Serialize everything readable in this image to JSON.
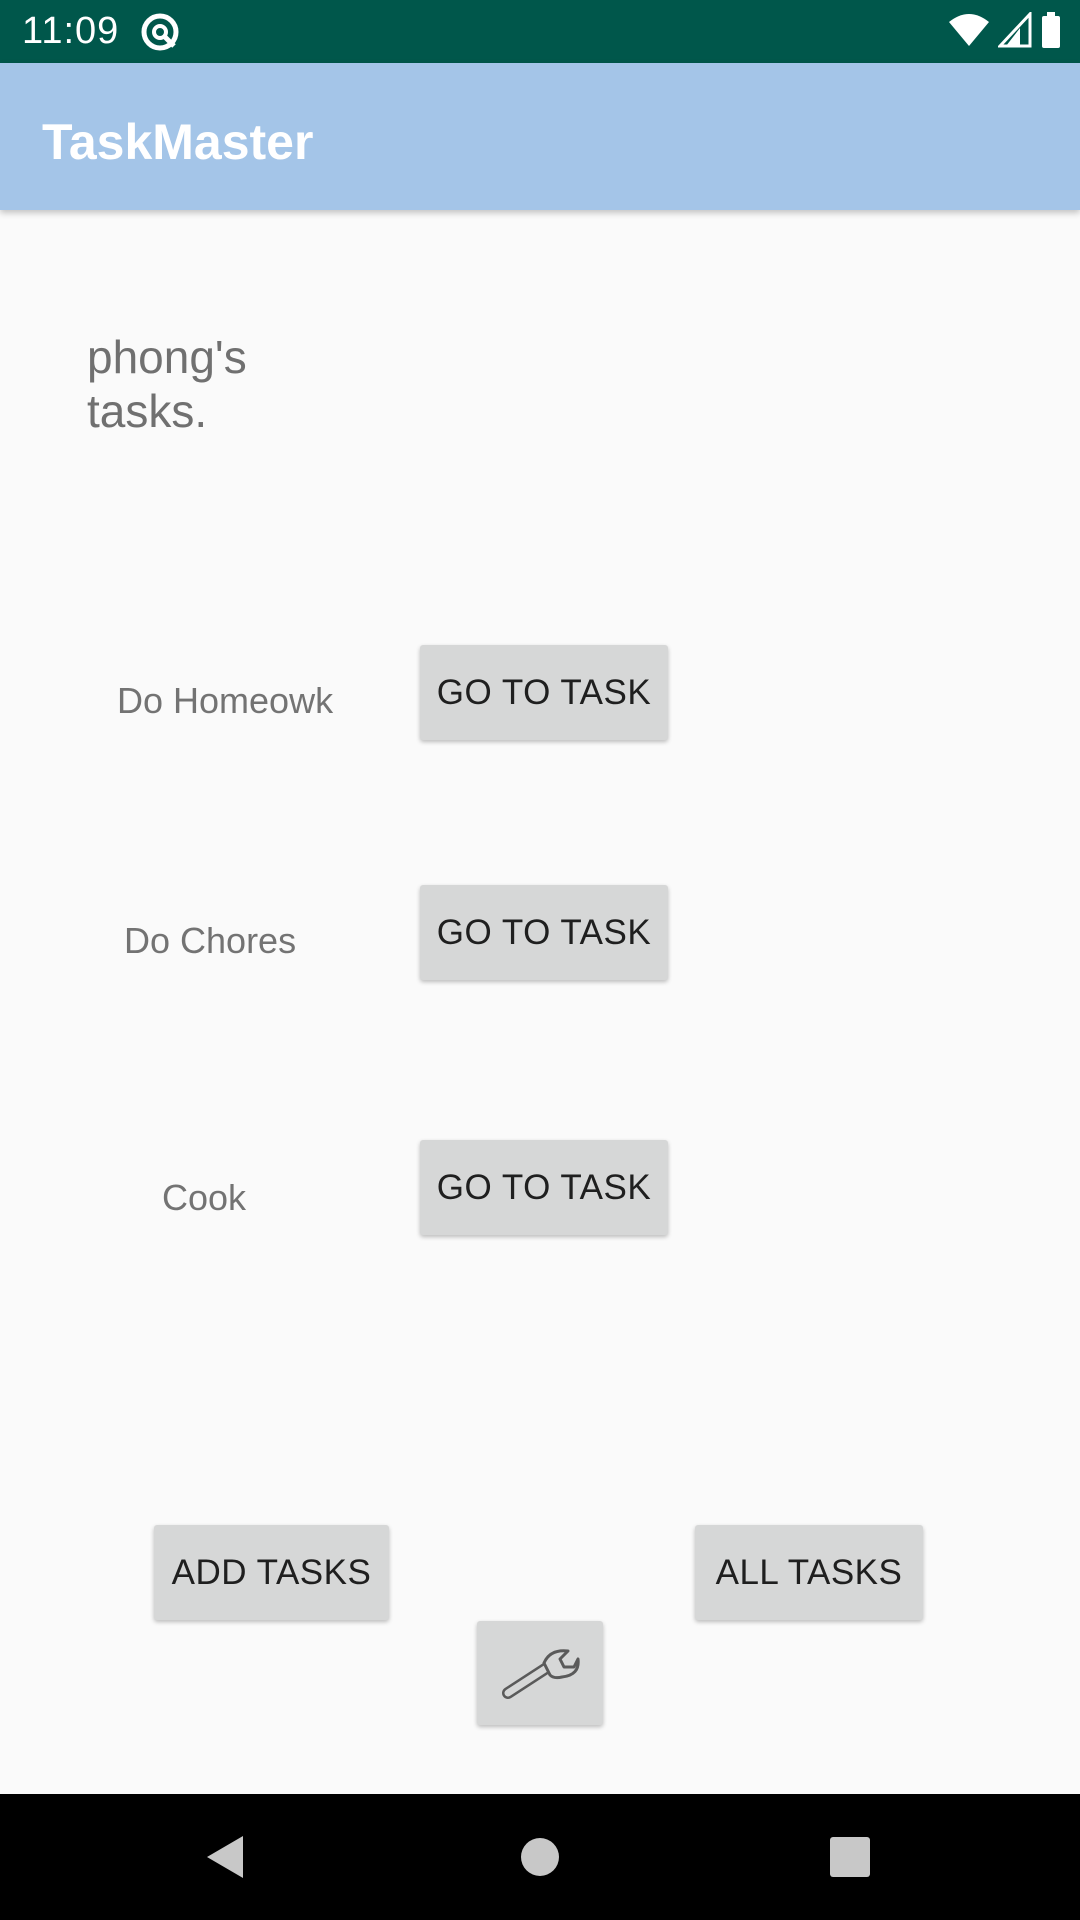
{
  "status_bar": {
    "time": "11:09",
    "icons": [
      "at-sign-icon",
      "wifi-icon",
      "cell-signal-icon",
      "battery-icon"
    ],
    "background": "#00574b"
  },
  "app_bar": {
    "title": "TaskMaster",
    "background": "#a4c5e8"
  },
  "greeting": "phong's tasks.",
  "tasks": [
    {
      "label": "Do Homeowk",
      "button": "GO TO TASK"
    },
    {
      "label": "Do Chores",
      "button": "GO TO TASK"
    },
    {
      "label": "Cook",
      "button": "GO TO TASK"
    }
  ],
  "footer": {
    "add_tasks": "ADD TASKS",
    "all_tasks": "ALL TASKS",
    "settings_icon": "wrench-icon"
  },
  "nav_bar": {
    "icons": [
      "back-icon",
      "home-icon",
      "recents-icon"
    ]
  }
}
